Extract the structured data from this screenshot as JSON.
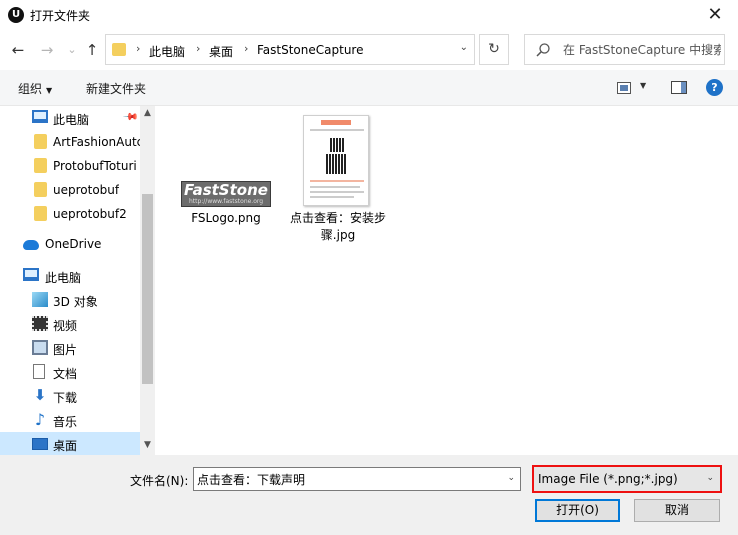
{
  "window": {
    "title": "打开文件夹",
    "app_icon_text": "U",
    "close_glyph": "✕"
  },
  "nav": {
    "back": "←",
    "forward": "→",
    "recent": "⌄",
    "up": "↑",
    "breadcrumbs": [
      "此电脑",
      "桌面",
      "FastStoneCapture"
    ],
    "sep": "›",
    "dropdown": "⌄",
    "refresh": "↻",
    "search_placeholder": "在 FastStoneCapture 中搜索"
  },
  "toolbar": {
    "organize": "组织",
    "organize_arrow": "▼",
    "new_folder": "新建文件夹",
    "view_arrow": "▼",
    "help": "?"
  },
  "sidebar": {
    "items": [
      {
        "label": "此电脑",
        "icon": "computer-icon",
        "pinned": true
      },
      {
        "label": "ArtFashionAutc",
        "icon": "folder-icon"
      },
      {
        "label": "ProtobufToturi",
        "icon": "folder-icon"
      },
      {
        "label": "ueprotobuf",
        "icon": "folder-icon"
      },
      {
        "label": "ueprotobuf2",
        "icon": "folder-icon"
      },
      {
        "label": "OneDrive",
        "icon": "onedrive-icon"
      },
      {
        "label": "此电脑",
        "icon": "computer-icon"
      },
      {
        "label": "3D 对象",
        "icon": "3d-objects-icon"
      },
      {
        "label": "视频",
        "icon": "video-icon"
      },
      {
        "label": "图片",
        "icon": "pictures-icon"
      },
      {
        "label": "文档",
        "icon": "documents-icon"
      },
      {
        "label": "下载",
        "icon": "download-icon",
        "glyph": "⬇"
      },
      {
        "label": "音乐",
        "icon": "music-icon",
        "glyph": "♪"
      },
      {
        "label": "桌面",
        "icon": "desktop-icon",
        "selected": true
      }
    ],
    "scroll_up": "▲",
    "scroll_down": "▼",
    "pin_glyph": "📌"
  },
  "files": [
    {
      "name": "FSLogo.png",
      "thumb_text": "FastStone",
      "thumb_subtext": "http://www.faststone.org"
    },
    {
      "name": "点击查看：安装步骤.jpg"
    }
  ],
  "footer": {
    "filename_label": "文件名(N):",
    "filename_value": "点击查看：下载声明",
    "filetype": "Image File (*.png;*.jpg)",
    "arrow": "⌄",
    "open_button": "打开(O)",
    "cancel_button": "取消"
  },
  "colors": {
    "selection": "#cce8ff",
    "highlight_border": "#e11111",
    "accent": "#0078d7"
  }
}
